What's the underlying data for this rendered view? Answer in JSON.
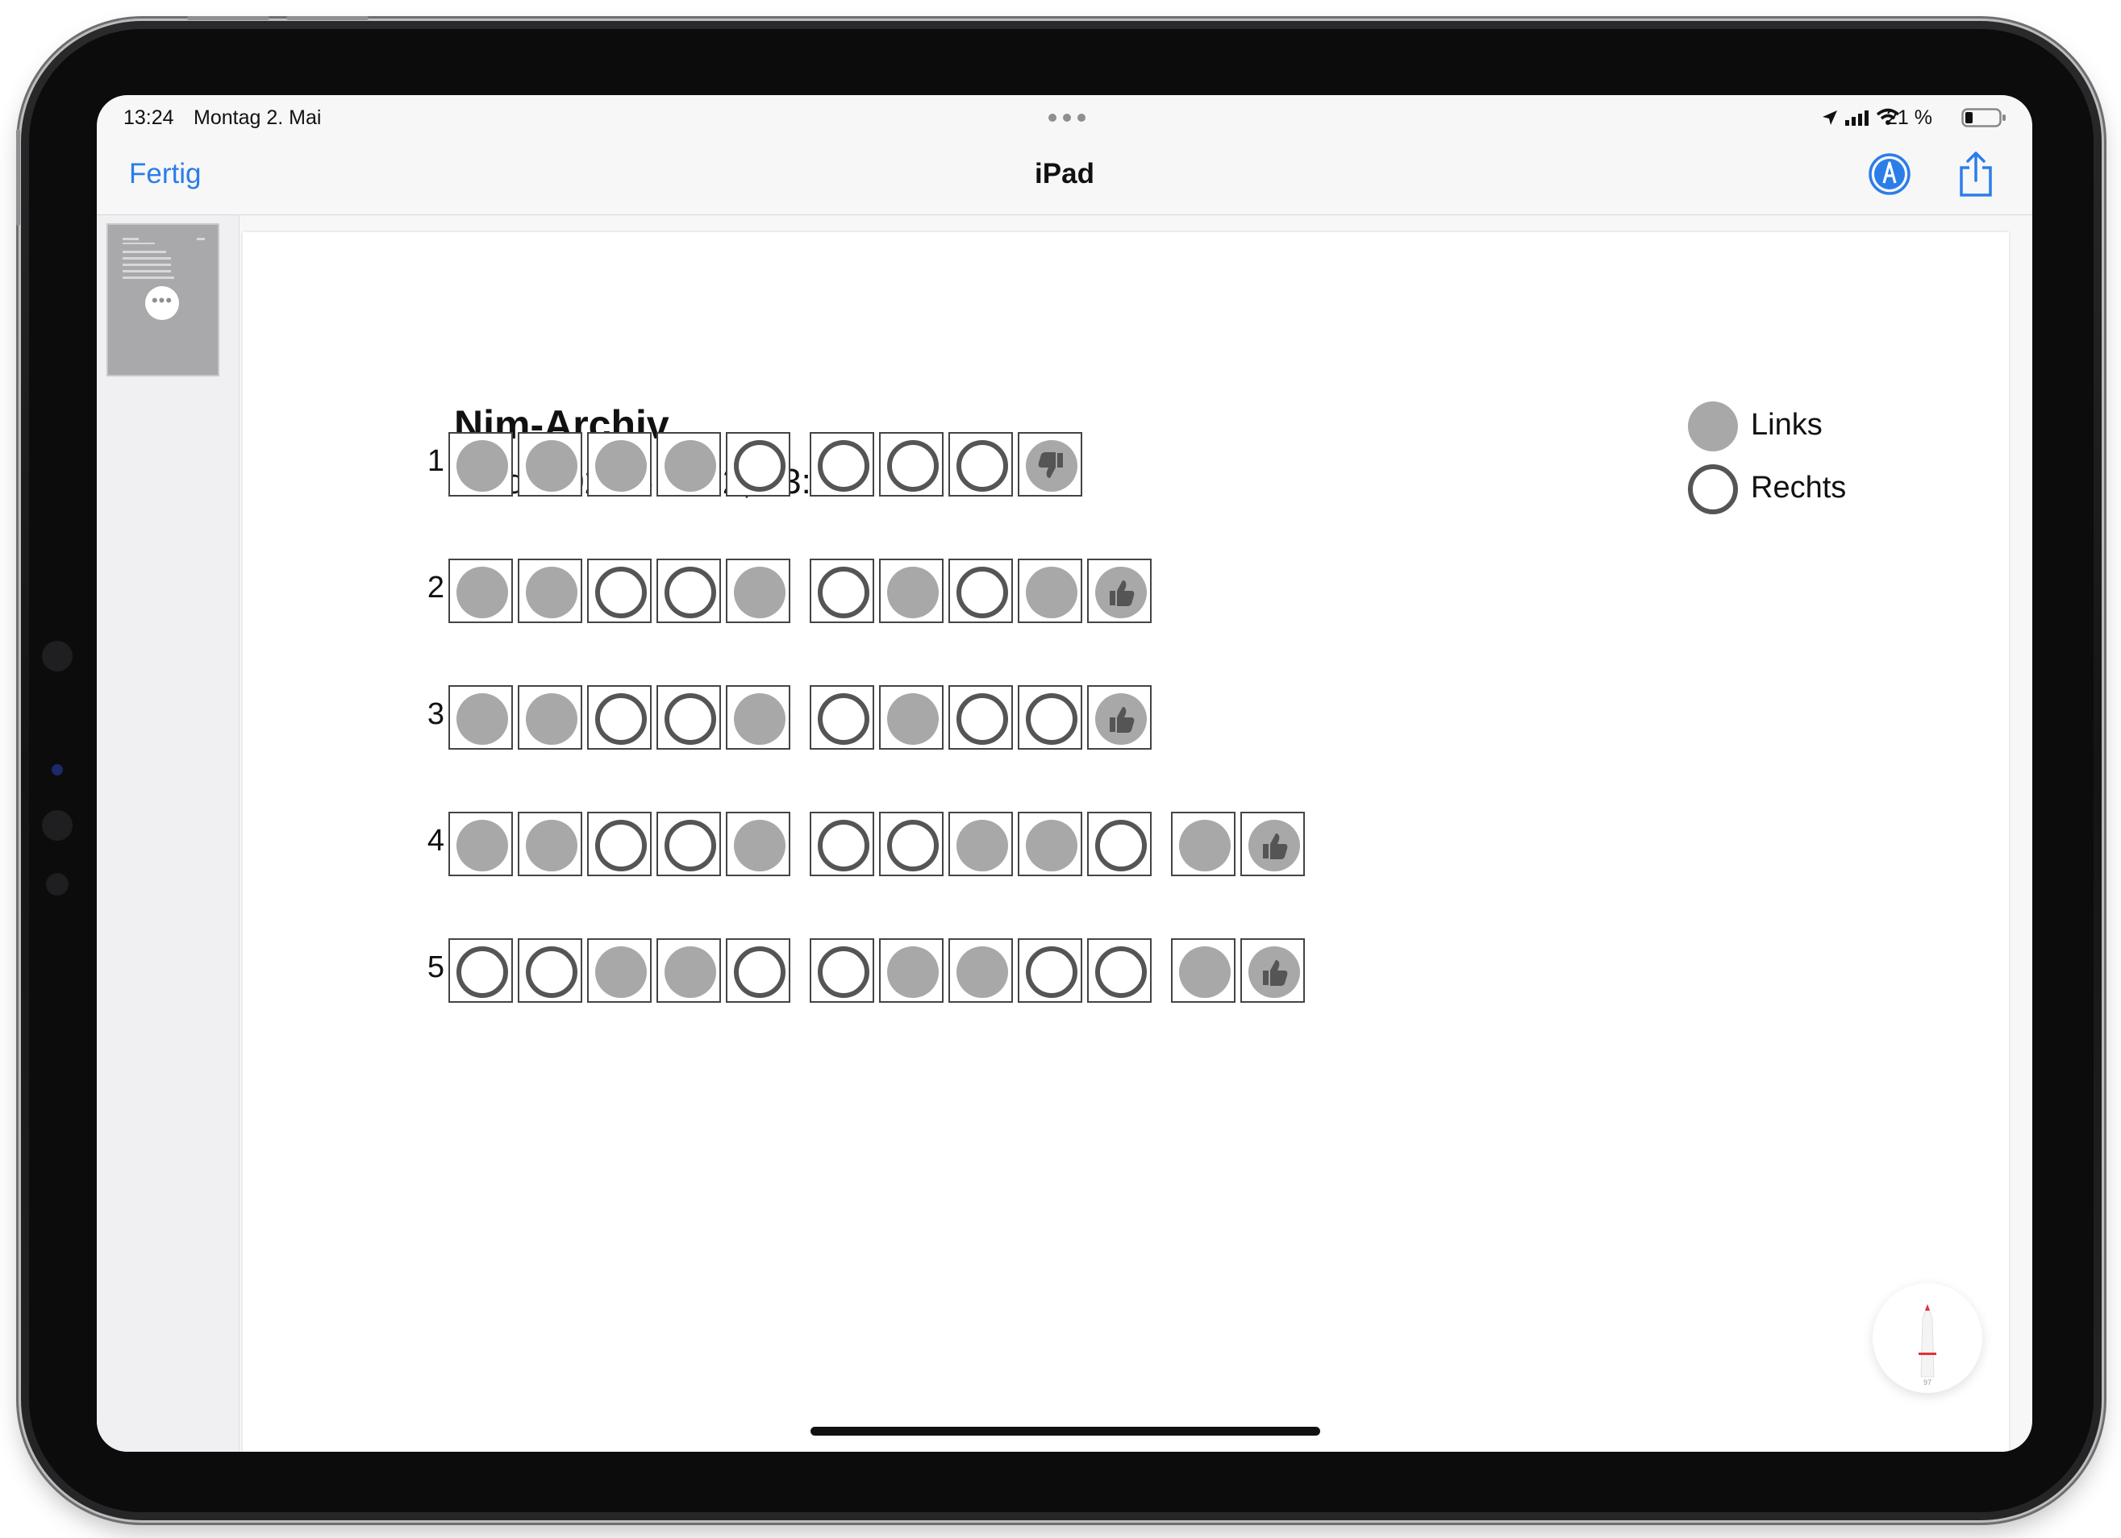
{
  "status_bar": {
    "time": "13:24",
    "date": "Montag 2. Mai",
    "battery": "21 %"
  },
  "nav": {
    "done_label": "Fertig",
    "title": "iPad"
  },
  "document": {
    "title": "Nim-Archiv",
    "subtitle": "iPad – 02.05.2022, 13:23",
    "legend": [
      {
        "style": "filled",
        "label": "Links"
      },
      {
        "style": "outline",
        "label": "Rechts"
      }
    ],
    "games": [
      {
        "number": "1",
        "groups": [
          [
            "L",
            "L",
            "L",
            "L",
            "R"
          ],
          [
            "R",
            "R",
            "R",
            "loss"
          ]
        ]
      },
      {
        "number": "2",
        "groups": [
          [
            "L",
            "L",
            "R",
            "R",
            "L"
          ],
          [
            "R",
            "L",
            "R",
            "L",
            "win"
          ]
        ]
      },
      {
        "number": "3",
        "groups": [
          [
            "L",
            "L",
            "R",
            "R",
            "L"
          ],
          [
            "R",
            "L",
            "R",
            "R",
            "win"
          ]
        ]
      },
      {
        "number": "4",
        "groups": [
          [
            "L",
            "L",
            "R",
            "R",
            "L"
          ],
          [
            "R",
            "R",
            "L",
            "L",
            "R"
          ],
          [
            "L",
            "win"
          ]
        ]
      },
      {
        "number": "5",
        "groups": [
          [
            "R",
            "R",
            "L",
            "L",
            "R"
          ],
          [
            "R",
            "L",
            "L",
            "R",
            "R"
          ],
          [
            "L",
            "win"
          ]
        ]
      }
    ]
  },
  "pencil": {
    "level": "97"
  },
  "colors": {
    "accent": "#2b7de9",
    "filled_token": "#a8a8a8",
    "outline_token": "#555555",
    "pencil_tip": "#e0333a"
  },
  "icons": {
    "location": "location-arrow-icon",
    "signal": "cellular-signal-icon",
    "wifi": "wifi-icon",
    "battery": "battery-icon",
    "markup": "markup-pen-icon",
    "share": "share-icon",
    "more": "more-icon",
    "pencil": "pencil-icon",
    "win": "thumbs-up-icon",
    "loss": "thumbs-down-icon"
  }
}
